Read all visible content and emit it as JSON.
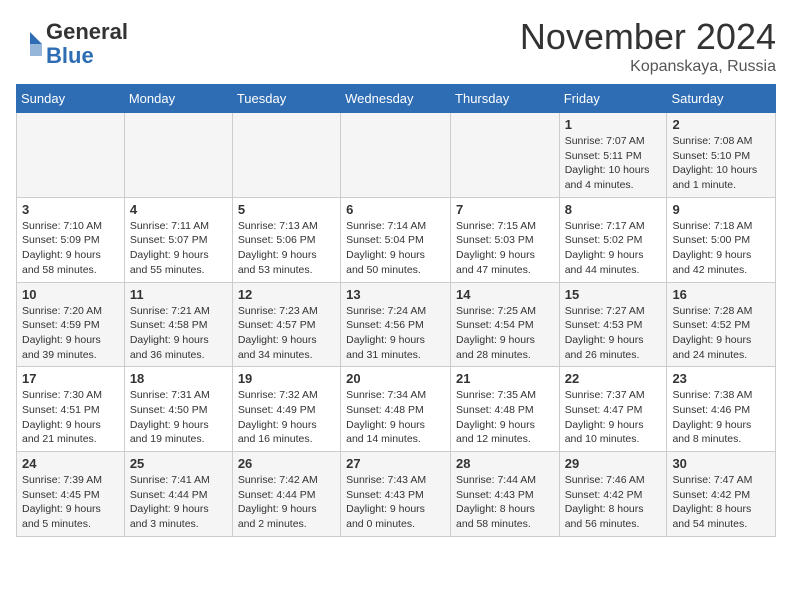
{
  "header": {
    "logo_general": "General",
    "logo_blue": "Blue",
    "month_title": "November 2024",
    "location": "Kopanskaya, Russia"
  },
  "columns": [
    "Sunday",
    "Monday",
    "Tuesday",
    "Wednesday",
    "Thursday",
    "Friday",
    "Saturday"
  ],
  "weeks": [
    [
      {
        "day": "",
        "info": ""
      },
      {
        "day": "",
        "info": ""
      },
      {
        "day": "",
        "info": ""
      },
      {
        "day": "",
        "info": ""
      },
      {
        "day": "",
        "info": ""
      },
      {
        "day": "1",
        "info": "Sunrise: 7:07 AM\nSunset: 5:11 PM\nDaylight: 10 hours and 4 minutes."
      },
      {
        "day": "2",
        "info": "Sunrise: 7:08 AM\nSunset: 5:10 PM\nDaylight: 10 hours and 1 minute."
      }
    ],
    [
      {
        "day": "3",
        "info": "Sunrise: 7:10 AM\nSunset: 5:09 PM\nDaylight: 9 hours and 58 minutes."
      },
      {
        "day": "4",
        "info": "Sunrise: 7:11 AM\nSunset: 5:07 PM\nDaylight: 9 hours and 55 minutes."
      },
      {
        "day": "5",
        "info": "Sunrise: 7:13 AM\nSunset: 5:06 PM\nDaylight: 9 hours and 53 minutes."
      },
      {
        "day": "6",
        "info": "Sunrise: 7:14 AM\nSunset: 5:04 PM\nDaylight: 9 hours and 50 minutes."
      },
      {
        "day": "7",
        "info": "Sunrise: 7:15 AM\nSunset: 5:03 PM\nDaylight: 9 hours and 47 minutes."
      },
      {
        "day": "8",
        "info": "Sunrise: 7:17 AM\nSunset: 5:02 PM\nDaylight: 9 hours and 44 minutes."
      },
      {
        "day": "9",
        "info": "Sunrise: 7:18 AM\nSunset: 5:00 PM\nDaylight: 9 hours and 42 minutes."
      }
    ],
    [
      {
        "day": "10",
        "info": "Sunrise: 7:20 AM\nSunset: 4:59 PM\nDaylight: 9 hours and 39 minutes."
      },
      {
        "day": "11",
        "info": "Sunrise: 7:21 AM\nSunset: 4:58 PM\nDaylight: 9 hours and 36 minutes."
      },
      {
        "day": "12",
        "info": "Sunrise: 7:23 AM\nSunset: 4:57 PM\nDaylight: 9 hours and 34 minutes."
      },
      {
        "day": "13",
        "info": "Sunrise: 7:24 AM\nSunset: 4:56 PM\nDaylight: 9 hours and 31 minutes."
      },
      {
        "day": "14",
        "info": "Sunrise: 7:25 AM\nSunset: 4:54 PM\nDaylight: 9 hours and 28 minutes."
      },
      {
        "day": "15",
        "info": "Sunrise: 7:27 AM\nSunset: 4:53 PM\nDaylight: 9 hours and 26 minutes."
      },
      {
        "day": "16",
        "info": "Sunrise: 7:28 AM\nSunset: 4:52 PM\nDaylight: 9 hours and 24 minutes."
      }
    ],
    [
      {
        "day": "17",
        "info": "Sunrise: 7:30 AM\nSunset: 4:51 PM\nDaylight: 9 hours and 21 minutes."
      },
      {
        "day": "18",
        "info": "Sunrise: 7:31 AM\nSunset: 4:50 PM\nDaylight: 9 hours and 19 minutes."
      },
      {
        "day": "19",
        "info": "Sunrise: 7:32 AM\nSunset: 4:49 PM\nDaylight: 9 hours and 16 minutes."
      },
      {
        "day": "20",
        "info": "Sunrise: 7:34 AM\nSunset: 4:48 PM\nDaylight: 9 hours and 14 minutes."
      },
      {
        "day": "21",
        "info": "Sunrise: 7:35 AM\nSunset: 4:48 PM\nDaylight: 9 hours and 12 minutes."
      },
      {
        "day": "22",
        "info": "Sunrise: 7:37 AM\nSunset: 4:47 PM\nDaylight: 9 hours and 10 minutes."
      },
      {
        "day": "23",
        "info": "Sunrise: 7:38 AM\nSunset: 4:46 PM\nDaylight: 9 hours and 8 minutes."
      }
    ],
    [
      {
        "day": "24",
        "info": "Sunrise: 7:39 AM\nSunset: 4:45 PM\nDaylight: 9 hours and 5 minutes."
      },
      {
        "day": "25",
        "info": "Sunrise: 7:41 AM\nSunset: 4:44 PM\nDaylight: 9 hours and 3 minutes."
      },
      {
        "day": "26",
        "info": "Sunrise: 7:42 AM\nSunset: 4:44 PM\nDaylight: 9 hours and 2 minutes."
      },
      {
        "day": "27",
        "info": "Sunrise: 7:43 AM\nSunset: 4:43 PM\nDaylight: 9 hours and 0 minutes."
      },
      {
        "day": "28",
        "info": "Sunrise: 7:44 AM\nSunset: 4:43 PM\nDaylight: 8 hours and 58 minutes."
      },
      {
        "day": "29",
        "info": "Sunrise: 7:46 AM\nSunset: 4:42 PM\nDaylight: 8 hours and 56 minutes."
      },
      {
        "day": "30",
        "info": "Sunrise: 7:47 AM\nSunset: 4:42 PM\nDaylight: 8 hours and 54 minutes."
      }
    ]
  ]
}
